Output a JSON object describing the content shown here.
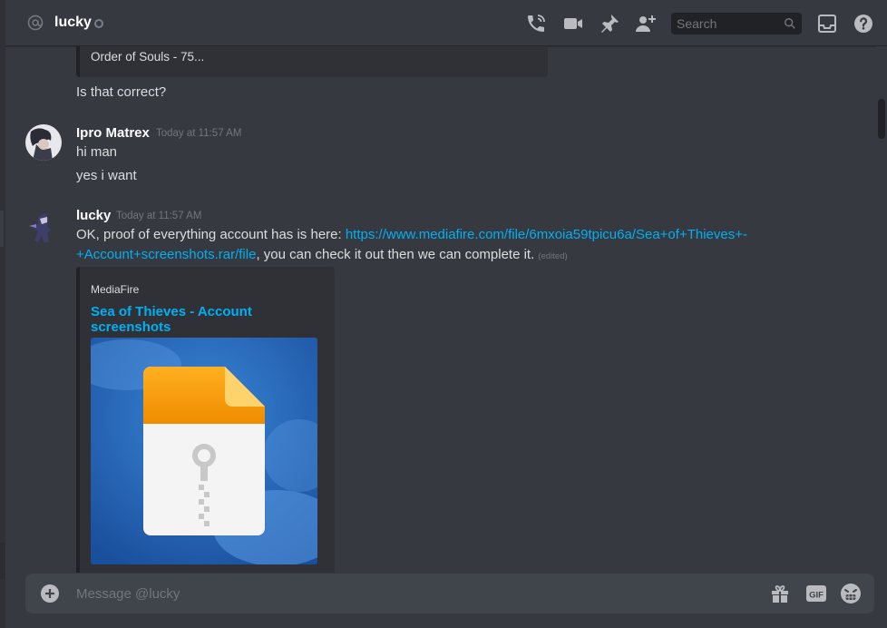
{
  "header": {
    "title": "lucky",
    "search_placeholder": "Search"
  },
  "messages": {
    "quote_text": "Order of Souls - 75...",
    "first_followup": "Is that correct?",
    "msg1": {
      "author": "Ipro Matrex",
      "timestamp": "Today at 11:57 AM",
      "line1": "hi man",
      "line2": "yes i want"
    },
    "msg2": {
      "author": "lucky",
      "timestamp": "Today at 11:57 AM",
      "text_before": "OK, proof of everything account has is here: ",
      "link_line1": "https://www.mediafire.com/file/6mxoia59tpicu6a/Sea+of+Thieves+-",
      "link_line2": "+Account+screenshots.rar/file",
      "text_after": ", you can check it out then we can complete it.",
      "edited": "(edited)"
    },
    "embed": {
      "provider": "MediaFire",
      "title": "Sea of Thieves - Account screenshots"
    }
  },
  "composer": {
    "placeholder": "Message @lucky"
  },
  "colors": {
    "background": "#36393f",
    "link": "#00b0f4",
    "muted": "#72767d"
  }
}
